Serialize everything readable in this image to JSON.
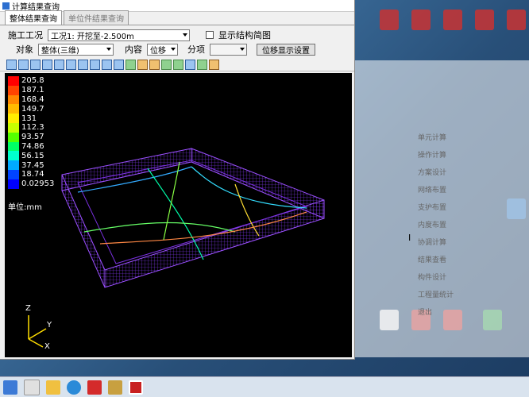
{
  "window": {
    "title": "计算结果查询"
  },
  "tabs": [
    {
      "label": "整体结果查询",
      "active": true
    },
    {
      "label": "单位件结果查询",
      "active": false
    }
  ],
  "controls": {
    "stage_label": "施工工况",
    "stage_value": "工况1: 开挖至-2.500m",
    "show_sketch_label": "显示结构简图",
    "show_sketch_checked": false,
    "object_label": "对象",
    "object_value": "整体(三维)",
    "content_label": "内容",
    "content_value": "位移",
    "component_label": "分项",
    "component_value": "",
    "display_settings_button": "位移显示设置"
  },
  "legend": {
    "values": [
      "205.8",
      "187.1",
      "168.4",
      "149.7",
      "131",
      "112.3",
      "93.57",
      "74.86",
      "56.15",
      "37.45",
      "18.74",
      "0.02953"
    ],
    "colors": [
      "#ff0000",
      "#ff4400",
      "#ff8800",
      "#ffbb00",
      "#ffee00",
      "#c8ff00",
      "#55ff00",
      "#00ff66",
      "#00ffcc",
      "#00aaff",
      "#0044ff",
      "#0000ff"
    ],
    "unit": "单位:mm"
  },
  "axes": {
    "z": "Z",
    "y": "Y",
    "x": "X"
  },
  "desktop_icons": [
    {
      "label": "",
      "color": "g-red"
    },
    {
      "label": "",
      "color": "g-blue"
    },
    {
      "label": "",
      "color": "g-green"
    },
    {
      "label": "",
      "color": "g-yellow"
    }
  ],
  "background_window": {
    "menu_items": [
      "单元计算",
      "操作计算",
      "方案设计",
      "网络布置",
      "支护布置",
      "内度布置",
      "协调计算",
      "结果查看",
      "构件设计",
      "工程量统计",
      "退出"
    ]
  }
}
